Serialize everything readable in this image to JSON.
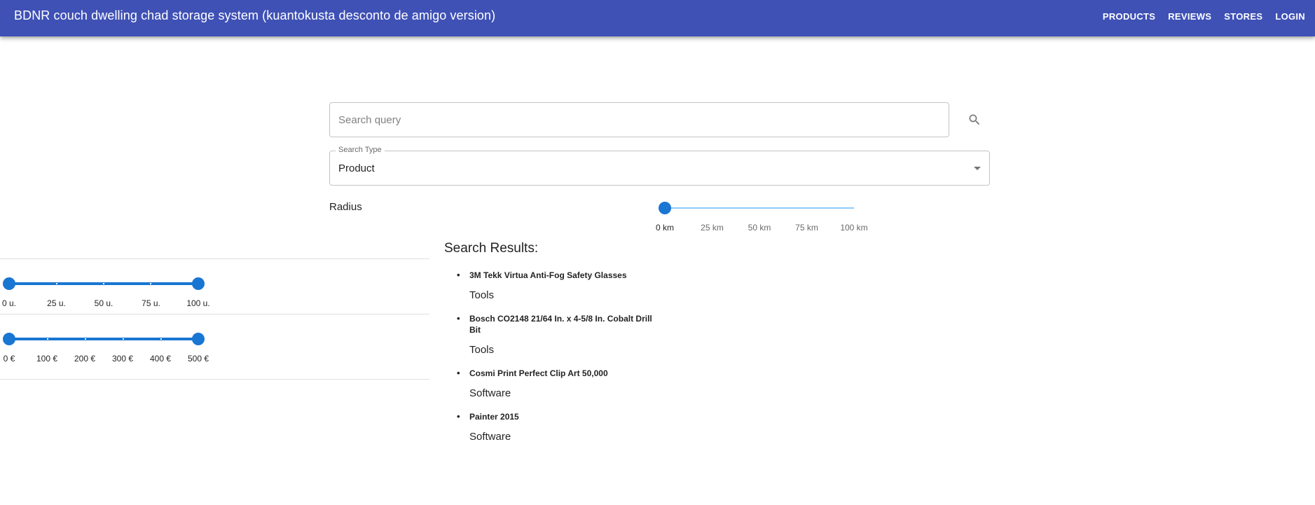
{
  "app": {
    "title": "BDNR couch dwelling chad storage system (kuantokusta desconto de amigo version)"
  },
  "nav": {
    "items": [
      "PRODUCTS",
      "REVIEWS",
      "STORES",
      "LOGIN"
    ]
  },
  "search": {
    "placeholder": "Search query",
    "value": ""
  },
  "search_type": {
    "label": "Search Type",
    "value": "Product"
  },
  "radius": {
    "label": "Radius",
    "value_km": 0,
    "marks": [
      "0 km",
      "25 km",
      "50 km",
      "75 km",
      "100 km"
    ]
  },
  "filters": {
    "quantity": {
      "marks": [
        "0 u.",
        "25 u.",
        "50 u.",
        "75 u.",
        "100 u."
      ],
      "range": [
        0,
        100
      ]
    },
    "price": {
      "marks": [
        "0 €",
        "100 €",
        "200 €",
        "300 €",
        "400 €",
        "500 €"
      ],
      "range": [
        0,
        500
      ]
    }
  },
  "results": {
    "heading": "Search Results:",
    "items": [
      {
        "name": "3M Tekk Virtua Anti-Fog Safety Glasses",
        "category": "Tools"
      },
      {
        "name": "Bosch CO2148 21/64 In. x 4-5/8 In. Cobalt Drill Bit",
        "category": "Tools"
      },
      {
        "name": "Cosmi Print Perfect Clip Art 50,000",
        "category": "Software"
      },
      {
        "name": "Painter 2015",
        "category": "Software"
      }
    ]
  },
  "colors": {
    "appbar": "#3f51b5",
    "primary": "#1976d2",
    "rail_light": "#90caf9"
  },
  "icons": {
    "search": "search-icon",
    "dropdown": "arrow-drop-down-icon"
  }
}
